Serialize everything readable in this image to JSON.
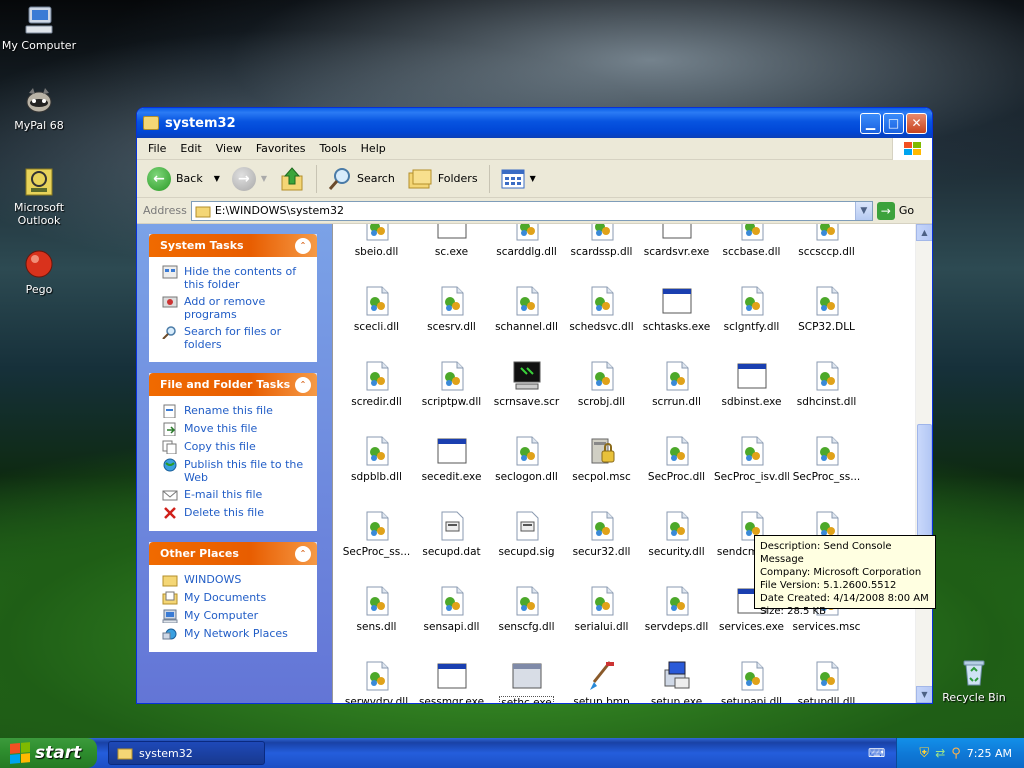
{
  "desktop": {
    "icons": [
      {
        "label": "My Computer",
        "icon": "my-computer-icon"
      },
      {
        "label": "MyPal 68",
        "icon": "mypal-icon"
      },
      {
        "label": "Microsoft Outlook",
        "icon": "outlook-icon"
      },
      {
        "label": "Pego",
        "icon": "pego-icon"
      },
      {
        "label": "Recycle Bin",
        "icon": "recycle-bin-icon"
      }
    ]
  },
  "window": {
    "title": "system32",
    "menu": [
      "File",
      "Edit",
      "View",
      "Favorites",
      "Tools",
      "Help"
    ],
    "toolbar": {
      "back": "Back",
      "search": "Search",
      "folders": "Folders"
    },
    "address": {
      "label": "Address",
      "value": "E:\\WINDOWS\\system32",
      "go": "Go"
    }
  },
  "tasks": {
    "system": {
      "title": "System Tasks",
      "items": [
        "Hide the contents of this folder",
        "Add or remove programs",
        "Search for files or folders"
      ]
    },
    "file": {
      "title": "File and Folder Tasks",
      "items": [
        "Rename this file",
        "Move this file",
        "Copy this file",
        "Publish this file to the Web",
        "E-mail this file",
        "Delete this file"
      ]
    },
    "other": {
      "title": "Other Places",
      "items": [
        "WINDOWS",
        "My Documents",
        "My Computer",
        "My Network Places"
      ]
    }
  },
  "files": [
    {
      "name": "sbeio.dll",
      "type": "dll"
    },
    {
      "name": "sc.exe",
      "type": "exe"
    },
    {
      "name": "scarddlg.dll",
      "type": "dll"
    },
    {
      "name": "scardssp.dll",
      "type": "dll"
    },
    {
      "name": "scardsvr.exe",
      "type": "exe"
    },
    {
      "name": "sccbase.dll",
      "type": "dll"
    },
    {
      "name": "sccsccp.dll",
      "type": "dll"
    },
    {
      "name": "scecli.dll",
      "type": "dll"
    },
    {
      "name": "scesrv.dll",
      "type": "dll"
    },
    {
      "name": "schannel.dll",
      "type": "dll"
    },
    {
      "name": "schedsvc.dll",
      "type": "dll"
    },
    {
      "name": "schtasks.exe",
      "type": "exe"
    },
    {
      "name": "sclgntfy.dll",
      "type": "dll"
    },
    {
      "name": "SCP32.DLL",
      "type": "dll"
    },
    {
      "name": "scredir.dll",
      "type": "dll"
    },
    {
      "name": "scriptpw.dll",
      "type": "dll"
    },
    {
      "name": "scrnsave.scr",
      "type": "scr"
    },
    {
      "name": "scrobj.dll",
      "type": "dll"
    },
    {
      "name": "scrrun.dll",
      "type": "dll"
    },
    {
      "name": "sdbinst.exe",
      "type": "exe"
    },
    {
      "name": "sdhcinst.dll",
      "type": "dll"
    },
    {
      "name": "sdpblb.dll",
      "type": "dll"
    },
    {
      "name": "secedit.exe",
      "type": "exe"
    },
    {
      "name": "seclogon.dll",
      "type": "dll"
    },
    {
      "name": "secpol.msc",
      "type": "msc"
    },
    {
      "name": "SecProc.dll",
      "type": "dll"
    },
    {
      "name": "SecProc_isv.dll",
      "type": "dll"
    },
    {
      "name": "SecProc_ss...",
      "type": "dll"
    },
    {
      "name": "SecProc_ss...",
      "type": "dll"
    },
    {
      "name": "secupd.dat",
      "type": "dat"
    },
    {
      "name": "secupd.sig",
      "type": "dat"
    },
    {
      "name": "secur32.dll",
      "type": "dll"
    },
    {
      "name": "security.dll",
      "type": "dll"
    },
    {
      "name": "sendcmsg.dll",
      "type": "dll"
    },
    {
      "name": "sens.dll",
      "type": "dll"
    },
    {
      "name": "sens.dll",
      "type": "dll"
    },
    {
      "name": "sensapi.dll",
      "type": "dll"
    },
    {
      "name": "senscfg.dll",
      "type": "dll"
    },
    {
      "name": "serialui.dll",
      "type": "dll"
    },
    {
      "name": "servdeps.dll",
      "type": "dll"
    },
    {
      "name": "services.exe",
      "type": "exe"
    },
    {
      "name": "services.msc",
      "type": "dll"
    },
    {
      "name": "serwvdrv.dll",
      "type": "dll"
    },
    {
      "name": "sessmgr.exe",
      "type": "exe"
    },
    {
      "name": "sethc.exe",
      "type": "exegray"
    },
    {
      "name": "setup.bmp",
      "type": "bmp"
    },
    {
      "name": "setup.exe",
      "type": "setup"
    },
    {
      "name": "setupapi.dll",
      "type": "dll"
    },
    {
      "name": "setupdll.dll",
      "type": "dll"
    }
  ],
  "tooltip": {
    "description": "Description: Send Console Message",
    "company": "Company: Microsoft Corporation",
    "version": "File Version: 5.1.2600.5512",
    "created": "Date Created: 4/14/2008 8:00 AM",
    "size": "Size: 28.5 KB"
  },
  "taskbar": {
    "start": "start",
    "task": "system32",
    "clock": "7:25 AM"
  },
  "colors": {
    "accent": "#0054e3",
    "taskpane_link": "#215dc6",
    "start_green": "#2f8f2f"
  }
}
